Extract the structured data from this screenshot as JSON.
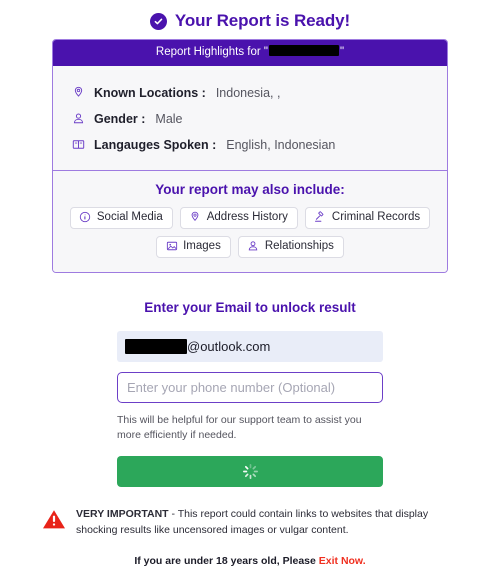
{
  "header": {
    "title": "Your Report is Ready!",
    "check_icon": "check-circle-icon",
    "accent_color": "#4A12AD"
  },
  "report_card": {
    "header_prefix": "Report Highlights for \"",
    "header_suffix": "\"",
    "redacted_name": "",
    "facts": [
      {
        "icon": "map-pin-icon",
        "label": "Known Locations :",
        "value": "Indonesia, ,"
      },
      {
        "icon": "person-icon",
        "label": "Gender :",
        "value": "Male"
      },
      {
        "icon": "book-icon",
        "label": "Langauges Spoken :",
        "value": "English, Indonesian"
      }
    ],
    "include": {
      "title": "Your report may also include:",
      "rows": [
        [
          {
            "icon": "info-circle-icon",
            "label": "Social Media"
          },
          {
            "icon": "map-pin-icon",
            "label": "Address History"
          },
          {
            "icon": "gavel-icon",
            "label": "Criminal Records"
          }
        ],
        [
          {
            "icon": "image-icon",
            "label": "Images"
          },
          {
            "icon": "person-icon",
            "label": "Relationships"
          }
        ]
      ]
    }
  },
  "form": {
    "heading": "Enter your Email to unlock result",
    "email_value_suffix": "@outlook.com",
    "phone_placeholder": "Enter your phone number (Optional)",
    "helper_text": "This will be helpful for our support team to assist you more efficiently if needed.",
    "submit_state": "loading",
    "submit_color": "#2CA75A"
  },
  "warning": {
    "icon": "warning-triangle-icon",
    "strong": "VERY IMPORTANT",
    "body": " - This report could contain links to websites that display shocking results like uncensored images or vulgar content.",
    "age_text": "If you are under 18 years old, Please ",
    "exit_link": "Exit Now.",
    "exit_color": "#F03020"
  }
}
